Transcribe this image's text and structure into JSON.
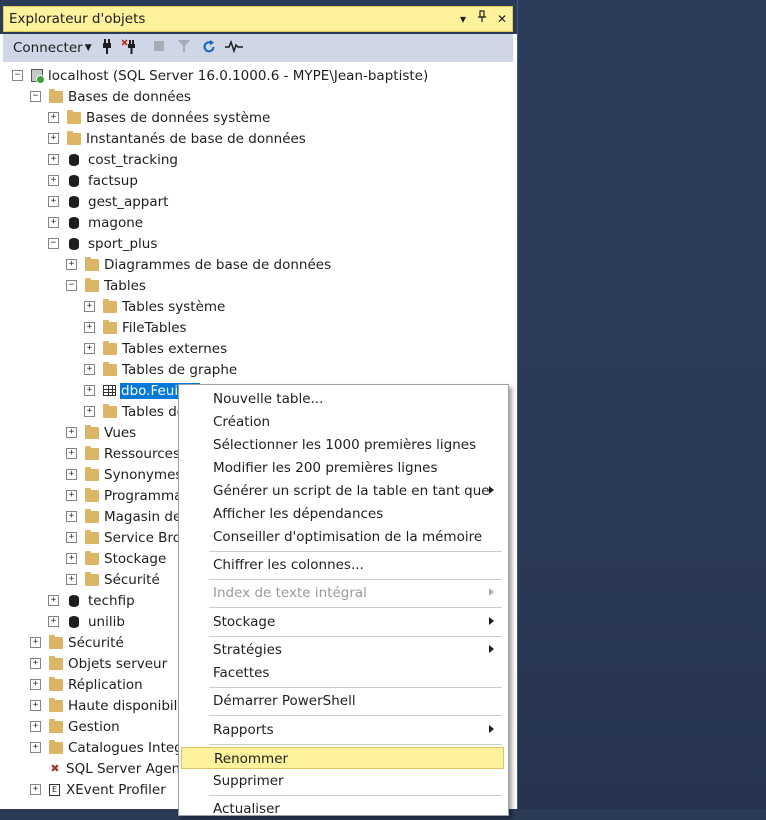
{
  "panel": {
    "title": "Explorateur d'objets",
    "title_buttons": {
      "dropdown": "▾",
      "pin": "🖈",
      "close": "✕"
    }
  },
  "toolbar": {
    "connect_label": "Connecter",
    "icons": [
      "connect-plug-icon",
      "disconnect-icon",
      "stop-icon",
      "filter-icon",
      "refresh-icon",
      "activity-monitor-icon"
    ]
  },
  "tree": {
    "server": "localhost (SQL Server 16.0.1000.6 - MYPE\\Jean-baptiste)",
    "databases": "Bases de données",
    "system_databases": "Bases de données système",
    "snapshots": "Instantanés de base de données",
    "db_cost_tracking": "cost_tracking",
    "db_factsup": "factsup",
    "db_gest_appart": "gest_appart",
    "db_magone": "magone",
    "db_sport_plus": "sport_plus",
    "sp_diagrams": "Diagrammes de base de données",
    "sp_tables": "Tables",
    "tables_system": "Tables système",
    "tables_file": "FileTables",
    "tables_external": "Tables externes",
    "tables_graph": "Tables de graphe",
    "table_selected": "dbo.Feuil1$",
    "tables_other": "Tables de",
    "sp_views": "Vues",
    "sp_resources": "Ressources e",
    "sp_synonyms": "Synonymes",
    "sp_programmability": "Programmal",
    "sp_store": "Magasin des",
    "sp_service_broker": "Service Brok",
    "sp_storage": "Stockage",
    "sp_security": "Sécurité",
    "db_techfip": "techfip",
    "db_unilib": "unilib",
    "security": "Sécurité",
    "server_objects": "Objets serveur",
    "replication": "Réplication",
    "high_availability": "Haute disponibilit",
    "management": "Gestion",
    "integration_catalogs": "Catalogues Integr",
    "agent": "SQL Server Agent",
    "xevent": "XEvent Profiler"
  },
  "context_menu": {
    "new_table": "Nouvelle table...",
    "design": "Création",
    "select_top": "Sélectionner les 1000 premières lignes",
    "edit_top": "Modifier les 200 premières lignes",
    "script_as": "Générer un script de la table en tant que",
    "dependencies": "Afficher les dépendances",
    "memory_advisor": "Conseiller d'optimisation de la mémoire",
    "encrypt": "Chiffrer les colonnes...",
    "fulltext": "Index de texte intégral",
    "storage": "Stockage",
    "policies": "Stratégies",
    "facets": "Facettes",
    "powershell": "Démarrer PowerShell",
    "reports": "Rapports",
    "rename": "Renommer",
    "delete": "Supprimer",
    "refresh": "Actualiser"
  },
  "colors": {
    "accent_yellow": "#fff29d",
    "selection_blue": "#0078d7",
    "background": "#2b3a55",
    "folder": "#dcb567"
  }
}
